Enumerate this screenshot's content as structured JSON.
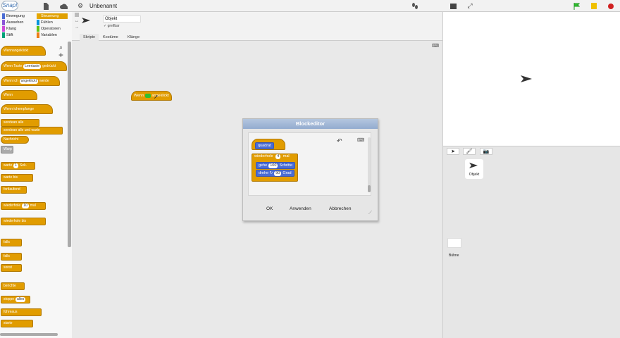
{
  "topbar": {
    "logo": "Snap!",
    "project_title": "Unbenannt"
  },
  "categories": [
    {
      "label": "Bewegung",
      "color": "#4a6cd4",
      "selected": false
    },
    {
      "label": "Steuerung",
      "color": "#e6a800",
      "selected": true
    },
    {
      "label": "Aussehen",
      "color": "#8a55d7",
      "selected": false
    },
    {
      "label": "Fühlen",
      "color": "#0494dc",
      "selected": false
    },
    {
      "label": "Klang",
      "color": "#cf4ad9",
      "selected": false
    },
    {
      "label": "Operatoren",
      "color": "#62c213",
      "selected": false
    },
    {
      "label": "Stift",
      "color": "#00a178",
      "selected": false
    },
    {
      "label": "Variablen",
      "color": "#ee7d16",
      "selected": false
    }
  ],
  "palette": [
    {
      "text": "Wenn",
      "slot": "",
      "post": "angeklickt",
      "hat": true
    },
    {
      "text": "Wenn Taste",
      "slot": "Leertaste",
      "post": "gedrückt",
      "hat": true
    },
    {
      "text": "Wenn ich",
      "slot": "angeklickt",
      "post": "werde",
      "hat": true
    },
    {
      "text": "Wenn",
      "slot": "",
      "post": "",
      "hat": true
    },
    {
      "text": "Wenn ich",
      "slot": "",
      "post": "empfange",
      "hat": true
    },
    {
      "text": "sende",
      "slot": "",
      "post": "an alle",
      "hat": false
    },
    {
      "text": "sende",
      "slot": "",
      "post": "an alle und warte",
      "hat": false
    },
    {
      "text": "Nachricht",
      "slot": "",
      "post": "",
      "hat": false,
      "pill": true
    },
    {
      "text": "Warp",
      "slot": "",
      "post": "",
      "hat": false,
      "gray": true
    },
    {
      "text": "warte",
      "slot": "1",
      "post": "Sek.",
      "hat": false
    },
    {
      "text": "warte bis",
      "slot": "",
      "post": "",
      "hat": false
    },
    {
      "text": "fortlaufend",
      "slot": "",
      "post": "",
      "hat": false
    },
    {
      "text": "wiederhole",
      "slot": "10",
      "post": "mal",
      "hat": false
    },
    {
      "text": "wiederhole bis",
      "slot": "",
      "post": "",
      "hat": false
    },
    {
      "text": "falls",
      "slot": "",
      "post": "",
      "hat": false
    },
    {
      "text": "falls",
      "slot": "",
      "post": "",
      "hat": false
    },
    {
      "text": "sonst",
      "slot": "",
      "post": "",
      "hat": false
    },
    {
      "text": "berichte",
      "slot": "",
      "post": "",
      "hat": false
    },
    {
      "text": "stoppe",
      "slot": "alles",
      "post": "",
      "hat": false
    },
    {
      "text": "führe",
      "slot": "",
      "post": "aus",
      "hat": false
    },
    {
      "text": "starte",
      "slot": "",
      "post": "",
      "hat": false
    }
  ],
  "sprite": {
    "name": "Objekt",
    "draggable_label": "greifbar",
    "tabs": [
      "Skripte",
      "Kostüme",
      "Klänge"
    ]
  },
  "script": {
    "text": "Wenn",
    "post": "angeklickt"
  },
  "dialog": {
    "title": "Blockeditor",
    "prototype": "quadrat",
    "repeat_label": "wiederhole",
    "repeat_count": "4",
    "repeat_unit": "mal",
    "move_label": "gehe",
    "move_steps": "100",
    "move_unit": "Schritte",
    "turn_label": "drehe",
    "turn_deg": "90",
    "turn_unit": "Grad",
    "ok": "OK",
    "apply": "Anwenden",
    "cancel": "Abbrechen"
  },
  "corral": {
    "sprite_name": "Objekt",
    "stage_name": "Bühne"
  }
}
